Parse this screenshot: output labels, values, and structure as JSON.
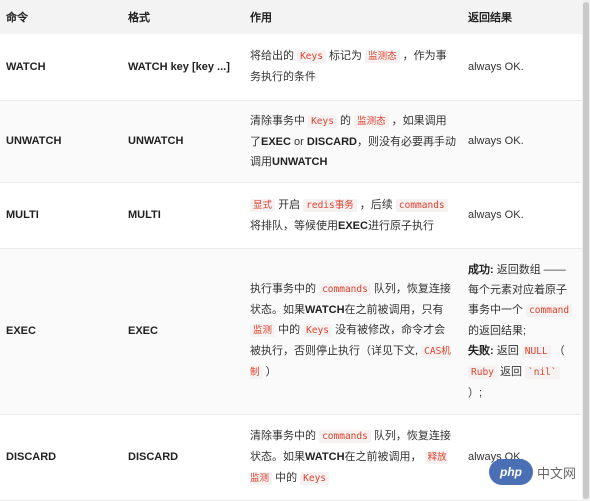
{
  "headers": {
    "command": "命令",
    "format": "格式",
    "usage": "作用",
    "return": "返回结果"
  },
  "rows": [
    {
      "command": "WATCH",
      "format": "WATCH key [key ...]",
      "usage": [
        {
          "t": "将给出的 "
        },
        {
          "t": "Keys",
          "k": "code"
        },
        {
          "t": " 标记为 "
        },
        {
          "t": "监测态",
          "k": "code"
        },
        {
          "t": " ，作为事务执行的条件"
        }
      ],
      "return": [
        {
          "t": "always OK."
        }
      ]
    },
    {
      "command": "UNWATCH",
      "format": "UNWATCH",
      "usage": [
        {
          "t": "清除事务中 "
        },
        {
          "t": "Keys",
          "k": "code"
        },
        {
          "t": " 的 "
        },
        {
          "t": "监测态",
          "k": "code"
        },
        {
          "t": " ，如果调用了"
        },
        {
          "t": "EXEC",
          "k": "b"
        },
        {
          "t": " or "
        },
        {
          "t": "DISCARD",
          "k": "b"
        },
        {
          "t": "，则没有必要再手动调用"
        },
        {
          "t": "UNWATCH",
          "k": "b"
        }
      ],
      "return": [
        {
          "t": "always OK."
        }
      ]
    },
    {
      "command": "MULTI",
      "format": "MULTI",
      "usage": [
        {
          "t": "显式",
          "k": "code"
        },
        {
          "t": " 开启 "
        },
        {
          "t": "redis事务",
          "k": "code"
        },
        {
          "t": " ，后续 "
        },
        {
          "t": "commands",
          "k": "code"
        },
        {
          "t": " 将排队，等候使用"
        },
        {
          "t": "EXEC",
          "k": "b"
        },
        {
          "t": "进行原子执行"
        }
      ],
      "return": [
        {
          "t": "always OK."
        }
      ]
    },
    {
      "command": "EXEC",
      "format": "EXEC",
      "usage": [
        {
          "t": "执行事务中的 "
        },
        {
          "t": "commands",
          "k": "code"
        },
        {
          "t": " 队列，恢复连接状态。如果"
        },
        {
          "t": "WATCH",
          "k": "b"
        },
        {
          "t": "在之前被调用，只有 "
        },
        {
          "t": "监测",
          "k": "code"
        },
        {
          "t": " 中的 "
        },
        {
          "t": "Keys",
          "k": "code"
        },
        {
          "t": " 没有被修改，命令才会被执行，否则停止执行（详见下文, "
        },
        {
          "t": "CAS机制",
          "k": "code"
        },
        {
          "t": " ）"
        }
      ],
      "return": [
        {
          "t": "成功:",
          "k": "b"
        },
        {
          "t": " 返回数组 —— 每个元素对应着原子事务中一个 "
        },
        {
          "t": "command",
          "k": "code"
        },
        {
          "t": " 的返回结果;"
        },
        {
          "t": "\n"
        },
        {
          "t": "失败:",
          "k": "b"
        },
        {
          "t": " 返回 "
        },
        {
          "t": "NULL",
          "k": "code"
        },
        {
          "t": " （ "
        },
        {
          "t": "Ruby",
          "k": "code"
        },
        {
          "t": " 返回 "
        },
        {
          "t": "`nil`",
          "k": "code"
        },
        {
          "t": " ）;"
        }
      ]
    },
    {
      "command": "DISCARD",
      "format": "DISCARD",
      "usage": [
        {
          "t": "清除事务中的 "
        },
        {
          "t": "commands",
          "k": "code"
        },
        {
          "t": " 队列，恢复连接状态。如果"
        },
        {
          "t": "WATCH",
          "k": "b"
        },
        {
          "t": "在之前被调用， "
        },
        {
          "t": "释放 监测",
          "k": "code"
        },
        {
          "t": " 中的 "
        },
        {
          "t": "Keys",
          "k": "code"
        }
      ],
      "return": [
        {
          "t": "always OK."
        }
      ]
    }
  ],
  "watermark": {
    "logo_text": "php",
    "site_text": "中文网"
  }
}
